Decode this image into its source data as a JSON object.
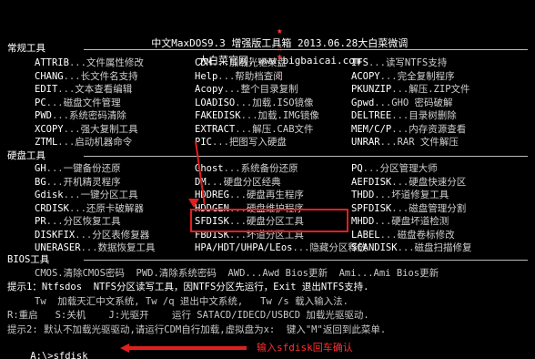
{
  "header": {
    "title": "中文MaxDOS9.3 增强版工具箱 2013.06.28大白菜微调",
    "subtitle": "大白菜官网：www.bigbaicai.com",
    "star_left": "★",
    "star_right": "★",
    "star_sub_left": "☆",
    "star_sub_right": "☆"
  },
  "sections": {
    "common": "常规工具",
    "disk": "硬盘工具",
    "bios": "BIOS工具"
  },
  "common_tools": [
    [
      "ATTRIB",
      "文件属性修改",
      "CDM",
      "加载光驱某盘",
      "IFS",
      "读写NTFS支持"
    ],
    [
      "CHANG",
      "长文件名支持",
      "Help",
      "帮助档查阅",
      "ACOPY",
      "完全复制程序"
    ],
    [
      "EDIT",
      "文本查看编辑",
      "Acopy",
      "整个目录复制",
      "PKUNZIP",
      "解压.ZIP文件"
    ],
    [
      "PC",
      "磁盘文件管理",
      "LOADISO",
      "加载.ISO镜像",
      "Gpwd",
      "GHO 密码破解"
    ],
    [
      "PWD",
      "系统密码清除",
      "FAKEDISK",
      "加载.IMG镜像",
      "DELTREE",
      "目录树删除"
    ],
    [
      "XCOPY",
      "强大复制工具",
      "EXTRACT",
      "解压.CAB文件",
      "MEM/C/P",
      "内存资源查看"
    ],
    [
      "ZTML",
      "启动机器命令",
      "PIC",
      "把图写入硬盘",
      "UNRAR",
      "RAR 文件解压"
    ]
  ],
  "disk_tools": [
    [
      "GH",
      "一键备份还原",
      "Ghost",
      "系统备份还原",
      "PQ",
      "分区管理大师"
    ],
    [
      "BG",
      "开机精灵程序",
      "DM",
      "硬盘分区经典",
      "AEFDISK",
      "硬盘快速分区"
    ],
    [
      "Gdisk",
      "一键分区工具",
      "HDDREG",
      "硬盘再生程序",
      "THDD",
      "坏道修复工具"
    ],
    [
      "CRDISK",
      "还原卡破解器",
      "HDDGEN",
      "硬盘维护程序",
      "SPFDISK",
      "磁盘管理分割"
    ],
    [
      "PR",
      "分区恢复工具",
      "SFDISK",
      "硬盘分区工具",
      "MHDD",
      "硬盘坏道检测"
    ],
    [
      "DISKFIX",
      "分区表修复器",
      "FBDISK",
      "坏道分区工具",
      "LABEL",
      "磁盘卷标修改"
    ],
    [
      "UNERASER",
      "数据恢复工具",
      "HPA/HDT/UHPA/LEos",
      "隐藏分区释放",
      "SCANDISK",
      "磁盘扫描修复"
    ]
  ],
  "bios_line": "CMOS.清除CMOS密码  PWD.清除系统密码  AWD...Awd Bios更新  Ami...Ami Bios更新",
  "hints": {
    "hint1": "提示1：Ntfsdos  NTFS分区读写工具，因NTFS分区先运行，Exit 退出NTFS支持.",
    "hint1b": "Tw  加载天汇中文系统, Tw /q 退出中文系统,   Tw /s 载入输入法.",
    "hint1c": "R:重启   S:关机    J:光驱开    运行 SATACD/IDECD/USBCD 加载光驱驱动.",
    "hint2": "提示2: 默认不加载光驱驱动,请运行CDM自行加载,虚拟盘为x:  键入\"M\"返回到此菜单."
  },
  "prompt": "A:\\>sfdisk",
  "annotation": "输入sfdisk回车确认",
  "colors": {
    "background": "#000000",
    "text": "#c8c8c8",
    "highlight": "#ffffff",
    "annotation": "#e02020"
  }
}
